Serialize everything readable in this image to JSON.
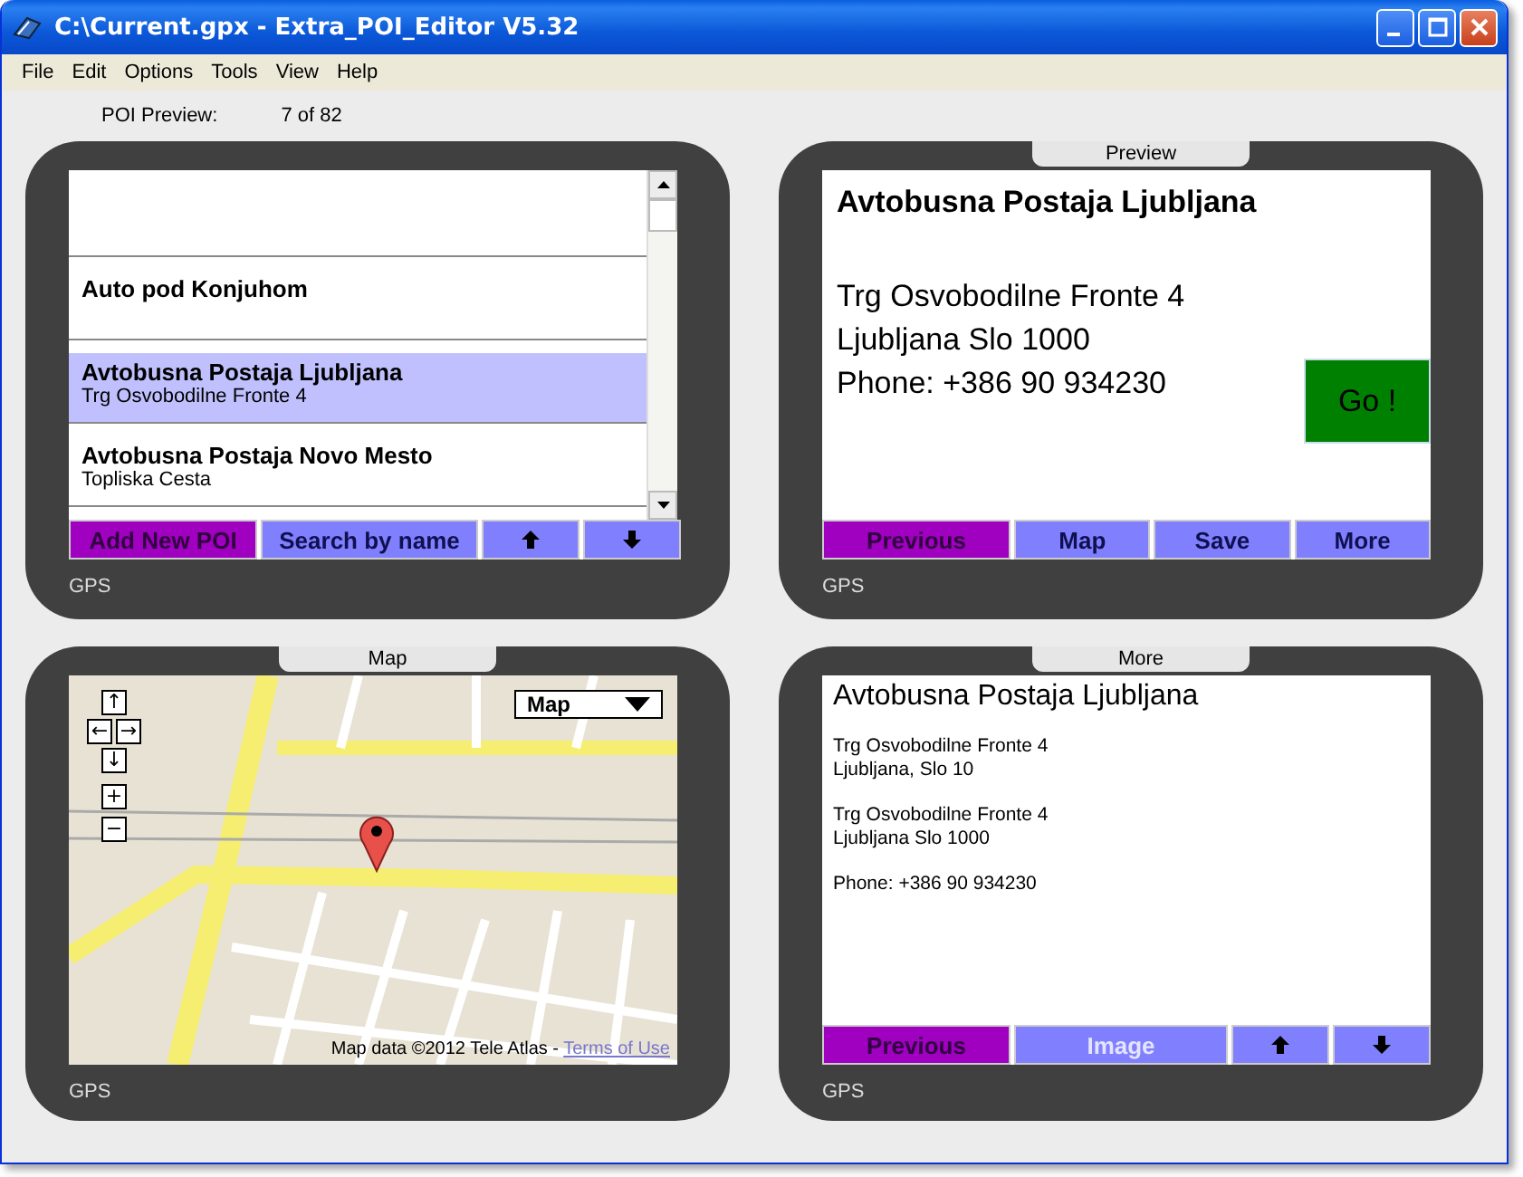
{
  "window": {
    "title": "C:\\Current.gpx - Extra_POI_Editor V5.32"
  },
  "menu": [
    "File",
    "Edit",
    "Options",
    "Tools",
    "View",
    "Help"
  ],
  "poi_preview": {
    "label": "POI Preview:",
    "counter": "7  of  82"
  },
  "panels": [
    {
      "kind": "list",
      "footer": "GPS",
      "rows": [
        {
          "selected": false
        },
        {
          "title": "Auto pod Konjuhom",
          "selected": false
        },
        {
          "title": "Avtobusna Postaja Ljubljana",
          "subtitle": "Trg Osvobodilne Fronte 4",
          "selected": true
        },
        {
          "title": "Avtobusna Postaja Novo Mesto",
          "subtitle": "Topliska Cesta",
          "selected": false
        }
      ],
      "buttons": [
        {
          "kind": "accent",
          "label": "Add New POI",
          "disabled": false
        },
        {
          "kind": "normal",
          "label": "Search by name",
          "disabled": false
        },
        {
          "kind": "up"
        },
        {
          "kind": "down"
        }
      ]
    },
    {
      "kind": "map",
      "title": "Map",
      "footer": "GPS",
      "pan_controls": [
        "↑",
        "←",
        "→",
        "↓"
      ],
      "zoom_controls": [
        "+",
        "−"
      ],
      "map_type": "Map",
      "attribution": "Map data ©2012 Tele Atlas - ",
      "terms_link": "Terms of Use"
    },
    {
      "kind": "preview",
      "title": "Preview",
      "footer": "GPS",
      "heading": "Avtobusna Postaja Ljubljana",
      "lines": [
        "Trg Osvobodilne Fronte 4",
        "Ljubljana Slo 1000",
        "Phone: +386 90 934230"
      ],
      "go_button": "Go !",
      "buttons": [
        {
          "kind": "accent",
          "label": "Previous",
          "disabled": false
        },
        {
          "kind": "normal",
          "label": "Map",
          "disabled": false
        },
        {
          "kind": "normal",
          "label": "Save",
          "disabled": false
        },
        {
          "kind": "normal",
          "label": "More",
          "disabled": false
        }
      ]
    },
    {
      "kind": "details",
      "title": "More",
      "footer": "GPS",
      "heading": "Avtobusna Postaja Ljubljana",
      "paragraphs": [
        [
          "Trg Osvobodilne Fronte 4",
          "Ljubljana, Slo 10"
        ],
        [
          "Trg Osvobodilne Fronte 4",
          "Ljubljana Slo 1000"
        ],
        [
          "Phone: +386 90 934230"
        ]
      ],
      "buttons": [
        {
          "kind": "accent",
          "label": "Previous",
          "disabled": false
        },
        {
          "kind": "normal",
          "label": "Image",
          "disabled": true
        },
        {
          "kind": "up"
        },
        {
          "kind": "down"
        }
      ]
    }
  ]
}
